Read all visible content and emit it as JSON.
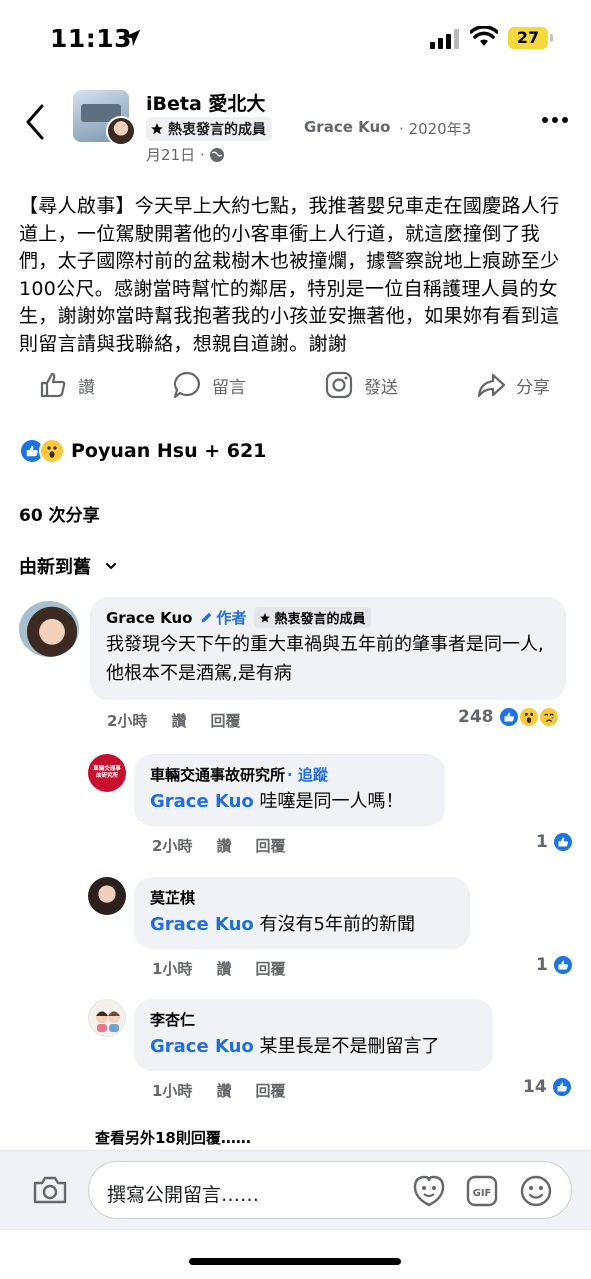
{
  "status_bar": {
    "time": "11:13",
    "battery": "27"
  },
  "header": {
    "group_name": "iBeta 愛北大",
    "badge_label": "熱衷發言的成員",
    "poster": "Grace Kuo",
    "date_part1": "· 2020年3",
    "date_part2": "月21日 ·"
  },
  "post": {
    "text": "【尋人啟事】今天早上大約七點，我推著嬰兒車走在國慶路人行道上，一位駕駛開著他的小客車衝上人行道，就這麼撞倒了我們，太子國際村前的盆栽樹木也被撞爛，據警察說地上痕跡至少100公尺。感謝當時幫忙的鄰居，特別是一位自稱護理人員的女生，謝謝妳當時幫我抱著我的小孩並安撫著他，如果妳有看到這則留言請與我聯絡，想親自道謝。謝謝"
  },
  "actions": {
    "like": "讚",
    "comment": "留言",
    "send": "發送",
    "share": "分享"
  },
  "reactions": {
    "summary": "Poyuan Hsu + 621"
  },
  "shares": "60 次分享",
  "sort_label": "由新到舊",
  "comments": [
    {
      "author": "Grace Kuo",
      "author_tag": "作者",
      "badge": "熱衷發言的成員",
      "text": "我發現今天下午的重大車禍與五年前的肇事者是同一人,他根本不是酒駕,是有病",
      "time": "2小時",
      "like": "讚",
      "reply": "回覆",
      "reactions": "248"
    },
    {
      "author": "車輛交通事故研究所",
      "follow": "· 追蹤",
      "mention": "Grace Kuo",
      "text": " 哇噻是同一人嗎！",
      "time": "2小時",
      "like": "讚",
      "reply": "回覆",
      "reactions": "1",
      "avatar_text": "車輛交通事故研究所"
    },
    {
      "author": "莫芷棋",
      "mention": "Grace Kuo",
      "text": " 有沒有5年前的新聞",
      "time": "1小時",
      "like": "讚",
      "reply": "回覆",
      "reactions": "1"
    },
    {
      "author": "李杏仁",
      "mention": "Grace Kuo",
      "text": " 某里長是不是刪留言了",
      "time": "1小時",
      "like": "讚",
      "reply": "回覆",
      "reactions": "14"
    }
  ],
  "view_more": "查看另外18則回覆……",
  "composer": {
    "placeholder": "撰寫公開留言……"
  },
  "colors": {
    "link": "#216fdb",
    "like_blue": "#1b74e4",
    "secondary": "#65676b",
    "bubble": "#f0f2f5"
  }
}
